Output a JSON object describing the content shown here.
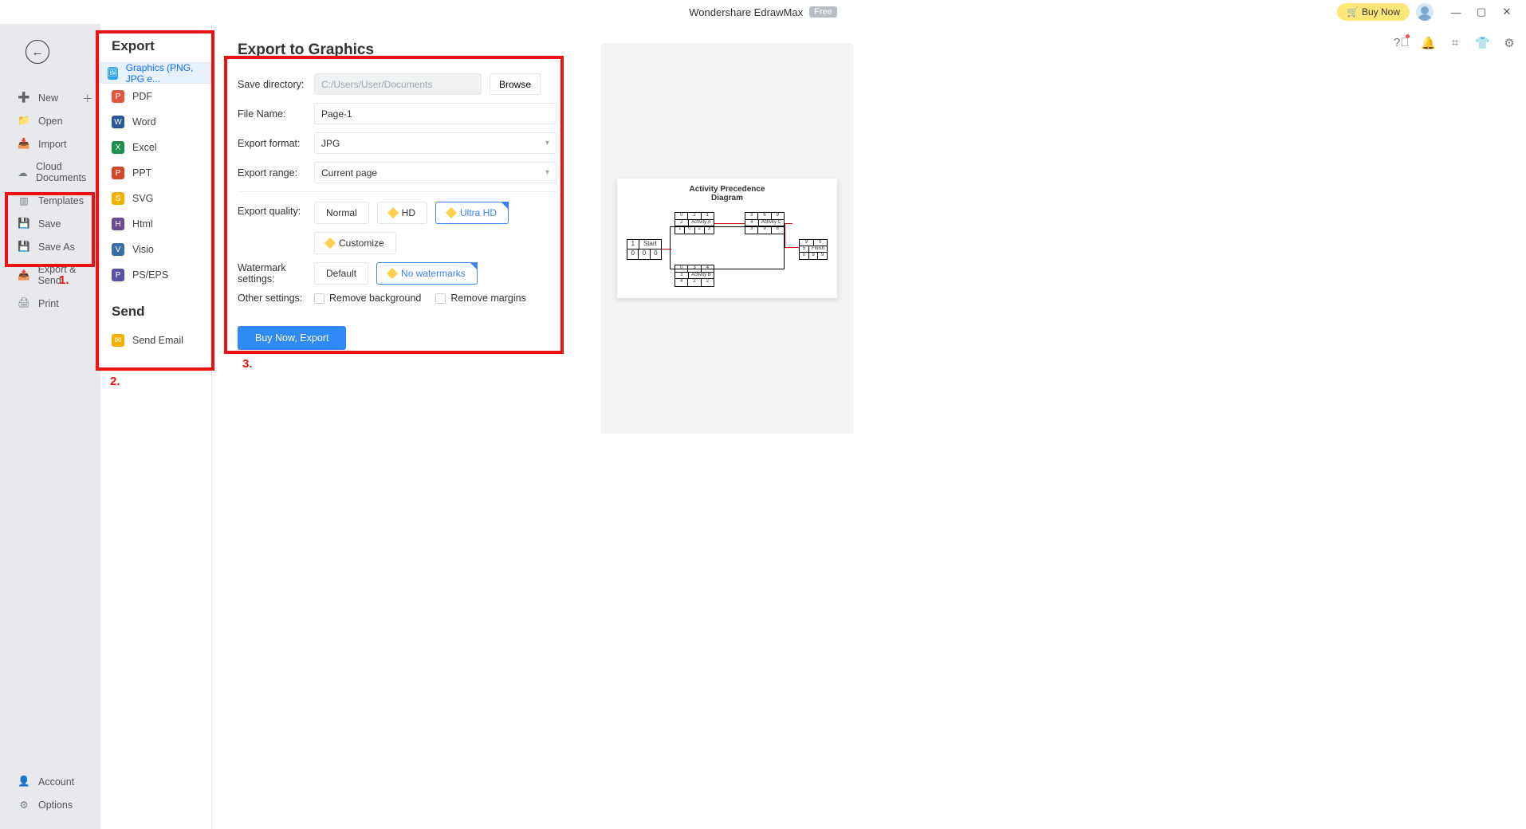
{
  "title": "Wondershare EdrawMax",
  "title_badge": "Free",
  "buy_label": "Buy Now",
  "left_menu": {
    "new": "New",
    "open": "Open",
    "import": "Import",
    "cloud": "Cloud Documents",
    "templates": "Templates",
    "save": "Save",
    "saveas": "Save As",
    "export": "Export & Send",
    "print": "Print",
    "account": "Account",
    "options": "Options"
  },
  "export": {
    "heading": "Export",
    "items": {
      "graphics": "Graphics (PNG, JPG e...",
      "pdf": "PDF",
      "word": "Word",
      "excel": "Excel",
      "ppt": "PPT",
      "svg": "SVG",
      "html": "Html",
      "visio": "Visio",
      "pseps": "PS/EPS"
    },
    "send_heading": "Send",
    "send_email": "Send Email"
  },
  "form": {
    "title": "Export to Graphics",
    "save_dir_lbl": "Save directory:",
    "save_dir": "C:/Users/User/Documents",
    "browse": "Browse",
    "filename_lbl": "File Name:",
    "filename": "Page-1",
    "format_lbl": "Export format:",
    "format": "JPG",
    "range_lbl": "Export range:",
    "range": "Current page",
    "quality_lbl": "Export quality:",
    "q_normal": "Normal",
    "q_hd": "HD",
    "q_uhd": "Ultra HD",
    "q_custom": "Customize",
    "watermark_lbl": "Watermark settings:",
    "wm_default": "Default",
    "wm_none": "No watermarks",
    "other_lbl": "Other settings:",
    "opt_bg": "Remove background",
    "opt_margins": "Remove margins",
    "action": "Buy Now, Export",
    "preview_title": "Activity Precedence\nDiagram"
  },
  "anno": {
    "n1": "1.",
    "n2": "2.",
    "n3": "3."
  },
  "diagram_labels": {
    "start": "Start",
    "finish": "Finish",
    "actA": "Activity A",
    "actB": "Activity B",
    "actC": "Activity C"
  }
}
